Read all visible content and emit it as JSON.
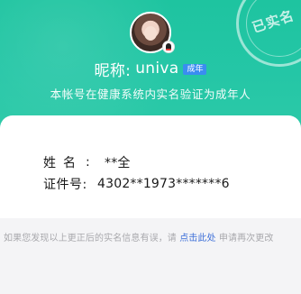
{
  "profile": {
    "nickname_label": "昵称:",
    "nickname": "univa",
    "adult_tag": "成年",
    "verify_statement": "本帐号在健康系统内实名验证为成年人",
    "stamp_text": "已实名"
  },
  "identity": {
    "name_label": "姓名",
    "name_colon": ":",
    "name_value": "**全",
    "id_label": "证件号:",
    "id_value": "4302**1973*******6"
  },
  "footer": {
    "prefix": "如果您发现以上更正后的实名信息有误，请 ",
    "link_text": "点击此处",
    "suffix": " 申请再次更改"
  },
  "colors": {
    "hero_green": "#24c6a6",
    "adult_tag_blue": "#3a8df0",
    "link_blue": "#3d6fd8"
  },
  "icons": {
    "avatar": "user-avatar",
    "badge": "qq-penguin-icon",
    "stamp": "verified-stamp-icon"
  }
}
